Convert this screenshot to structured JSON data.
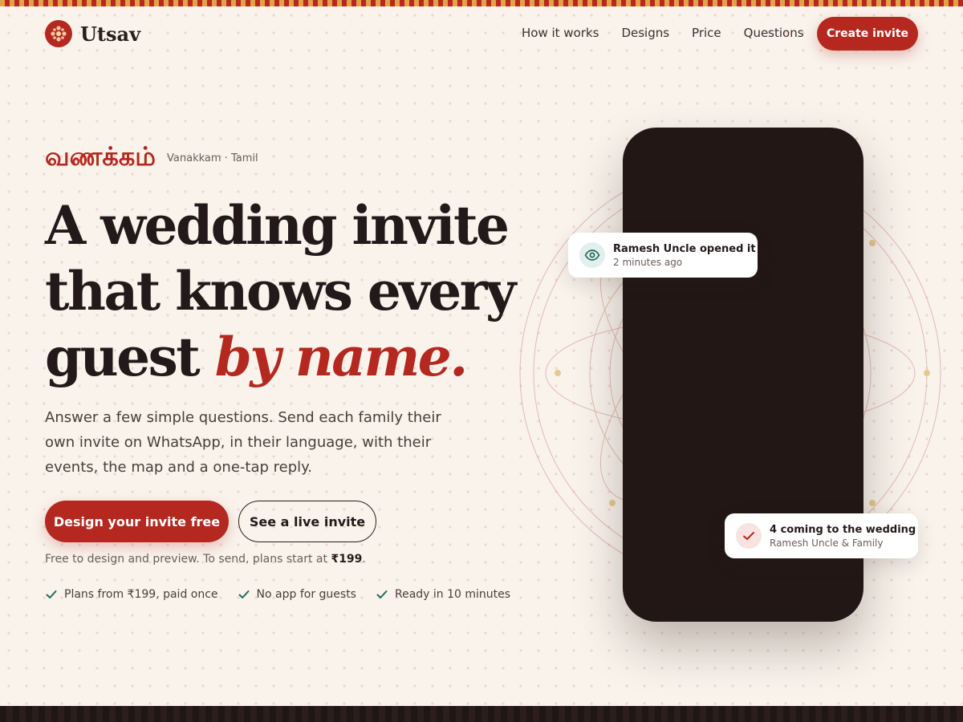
{
  "brand": {
    "name": "Utsav",
    "accent": "#b4281f"
  },
  "nav": {
    "items": [
      {
        "label": "How it works"
      },
      {
        "label": "Designs"
      },
      {
        "label": "Price"
      },
      {
        "label": "Questions"
      }
    ],
    "cta_label": "Create invite"
  },
  "hero": {
    "greeting_native": "வணக்கம்",
    "greeting_caption": "Vanakkam · Tamil",
    "headline_line1": "A wedding invite",
    "headline_line2": "that knows every",
    "headline_line3_plain": "guest ",
    "headline_line3_emphasis": "by name.",
    "lead": "Answer a few simple questions. Send each family their own invite on WhatsApp, in their language, with their events, the map and a one-tap reply.",
    "primary_cta": "Design your invite free",
    "secondary_cta": "See a live invite",
    "pricing_note_prefix": "Free to design and preview. To send, plans start at ",
    "pricing_note_price": "₹199",
    "pricing_note_suffix": ".",
    "features": [
      {
        "label": "Plans from ₹199, paid once",
        "icon": "check-icon"
      },
      {
        "label": "No app for guests",
        "icon": "check-icon"
      },
      {
        "label": "Ready in 10 minutes",
        "icon": "check-icon"
      }
    ]
  },
  "phone": {
    "opened_card": {
      "title": "Ramesh Uncle opened it",
      "subtitle": "2 minutes ago",
      "icon": "eye-icon"
    },
    "rsvp_card": {
      "title": "4 coming to the wedding",
      "subtitle": "Ramesh Uncle & Family",
      "icon": "check-icon"
    }
  },
  "colors": {
    "background": "#f9f3ec",
    "primary": "#b4281f",
    "text": "#24191a",
    "check": "#1f6b5c",
    "phone": "#221715"
  }
}
